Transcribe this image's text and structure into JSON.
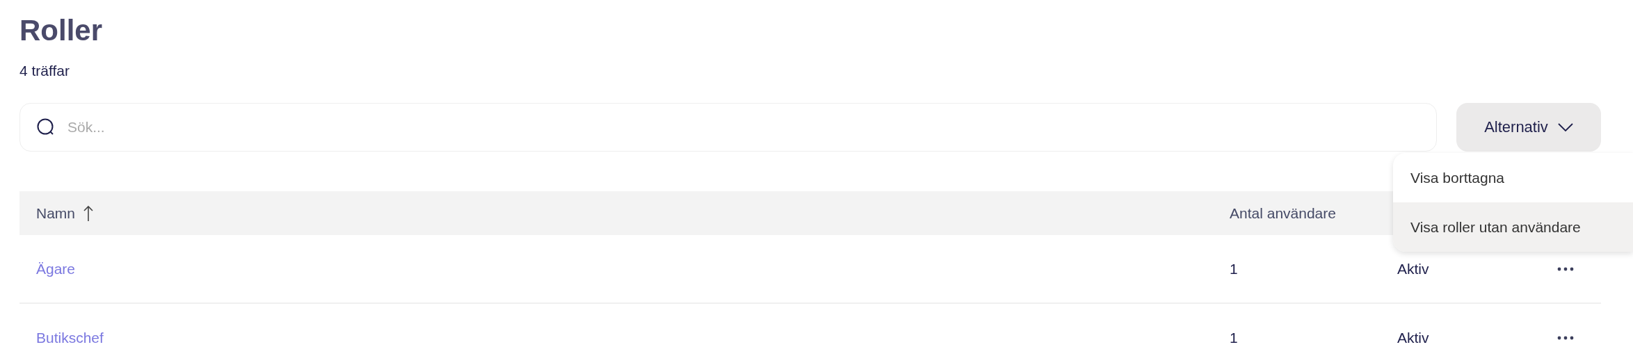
{
  "title": "Roller",
  "count": "4 träffar",
  "search": {
    "placeholder": "Sök..."
  },
  "options_button": {
    "label": "Alternativ",
    "expanded": true
  },
  "options_menu": [
    {
      "label": "Visa borttagna",
      "highlighted": false
    },
    {
      "label": "Visa roller utan användare",
      "highlighted": true
    }
  ],
  "table": {
    "columns": [
      {
        "label": "Namn",
        "sorted": true
      },
      {
        "label": "Antal användare",
        "sorted": false
      }
    ],
    "rows": [
      {
        "name": "Ägare",
        "users": "1",
        "status": "Aktiv"
      },
      {
        "name": "Butikschef",
        "users": "1",
        "status": "Aktiv"
      }
    ]
  }
}
